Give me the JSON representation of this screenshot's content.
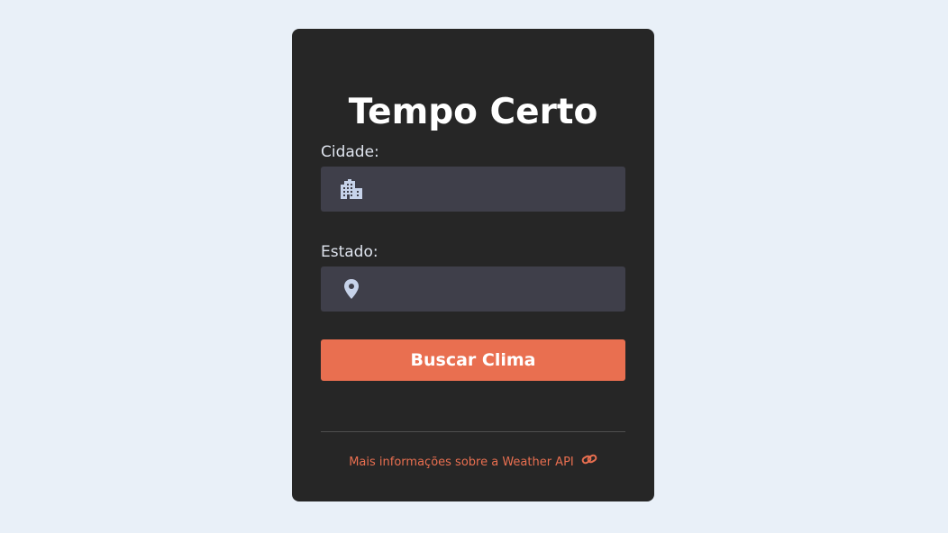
{
  "app": {
    "title": "Tempo Certo"
  },
  "form": {
    "city_label": "Cidade:",
    "city_value": "",
    "city_icon": "city-buildings-icon",
    "state_label": "Estado:",
    "state_value": "",
    "state_icon": "map-pin-icon",
    "submit_label": "Buscar Clima"
  },
  "footer": {
    "link_text": "Mais informações sobre a Weather API",
    "link_icon": "link-chain-icon"
  },
  "colors": {
    "background": "#e9f0f8",
    "card": "#262626",
    "input_bg": "#3f3f4a",
    "accent": "#e96f50",
    "icon": "#c7d3ea"
  }
}
